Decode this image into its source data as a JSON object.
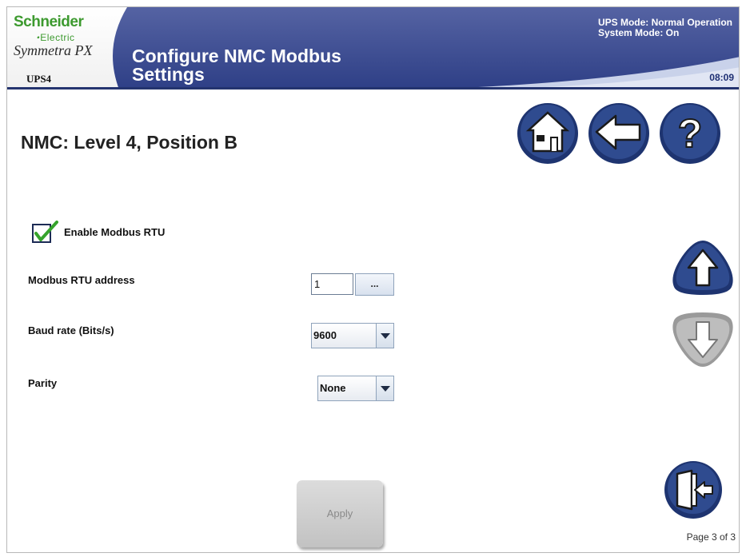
{
  "header": {
    "brand": "Schneider",
    "brand_sub": "Electric",
    "product": "Symmetra PX",
    "device": "UPS4",
    "title": "Configure NMC Modbus Settings",
    "ups_mode": "UPS Mode: Normal Operation",
    "system_mode": "System Mode: On",
    "time": "08:09"
  },
  "nav": {
    "home_icon": "home-icon",
    "back_icon": "back-arrow-icon",
    "help_icon": "help-icon",
    "scroll_up_icon": "up-arrow-icon",
    "scroll_down_icon": "down-arrow-icon",
    "exit_icon": "exit-door-icon"
  },
  "content": {
    "nmc_title": "NMC: Level 4, Position B",
    "enable_label": "Enable Modbus RTU",
    "enable_checked": true,
    "address_label": "Modbus RTU address",
    "address_value": "1",
    "address_button": "...",
    "baud_label": "Baud rate (Bits/s)",
    "baud_value": "9600",
    "parity_label": "Parity",
    "parity_value": "None",
    "apply_label": "Apply"
  },
  "footer": {
    "page": "Page 3 of 3"
  },
  "colors": {
    "header_blue": "#3a4a8c",
    "brand_green": "#3d9a2f",
    "nav_button_blue": "#253d7c",
    "disabled_gray": "#c4c4c4"
  }
}
